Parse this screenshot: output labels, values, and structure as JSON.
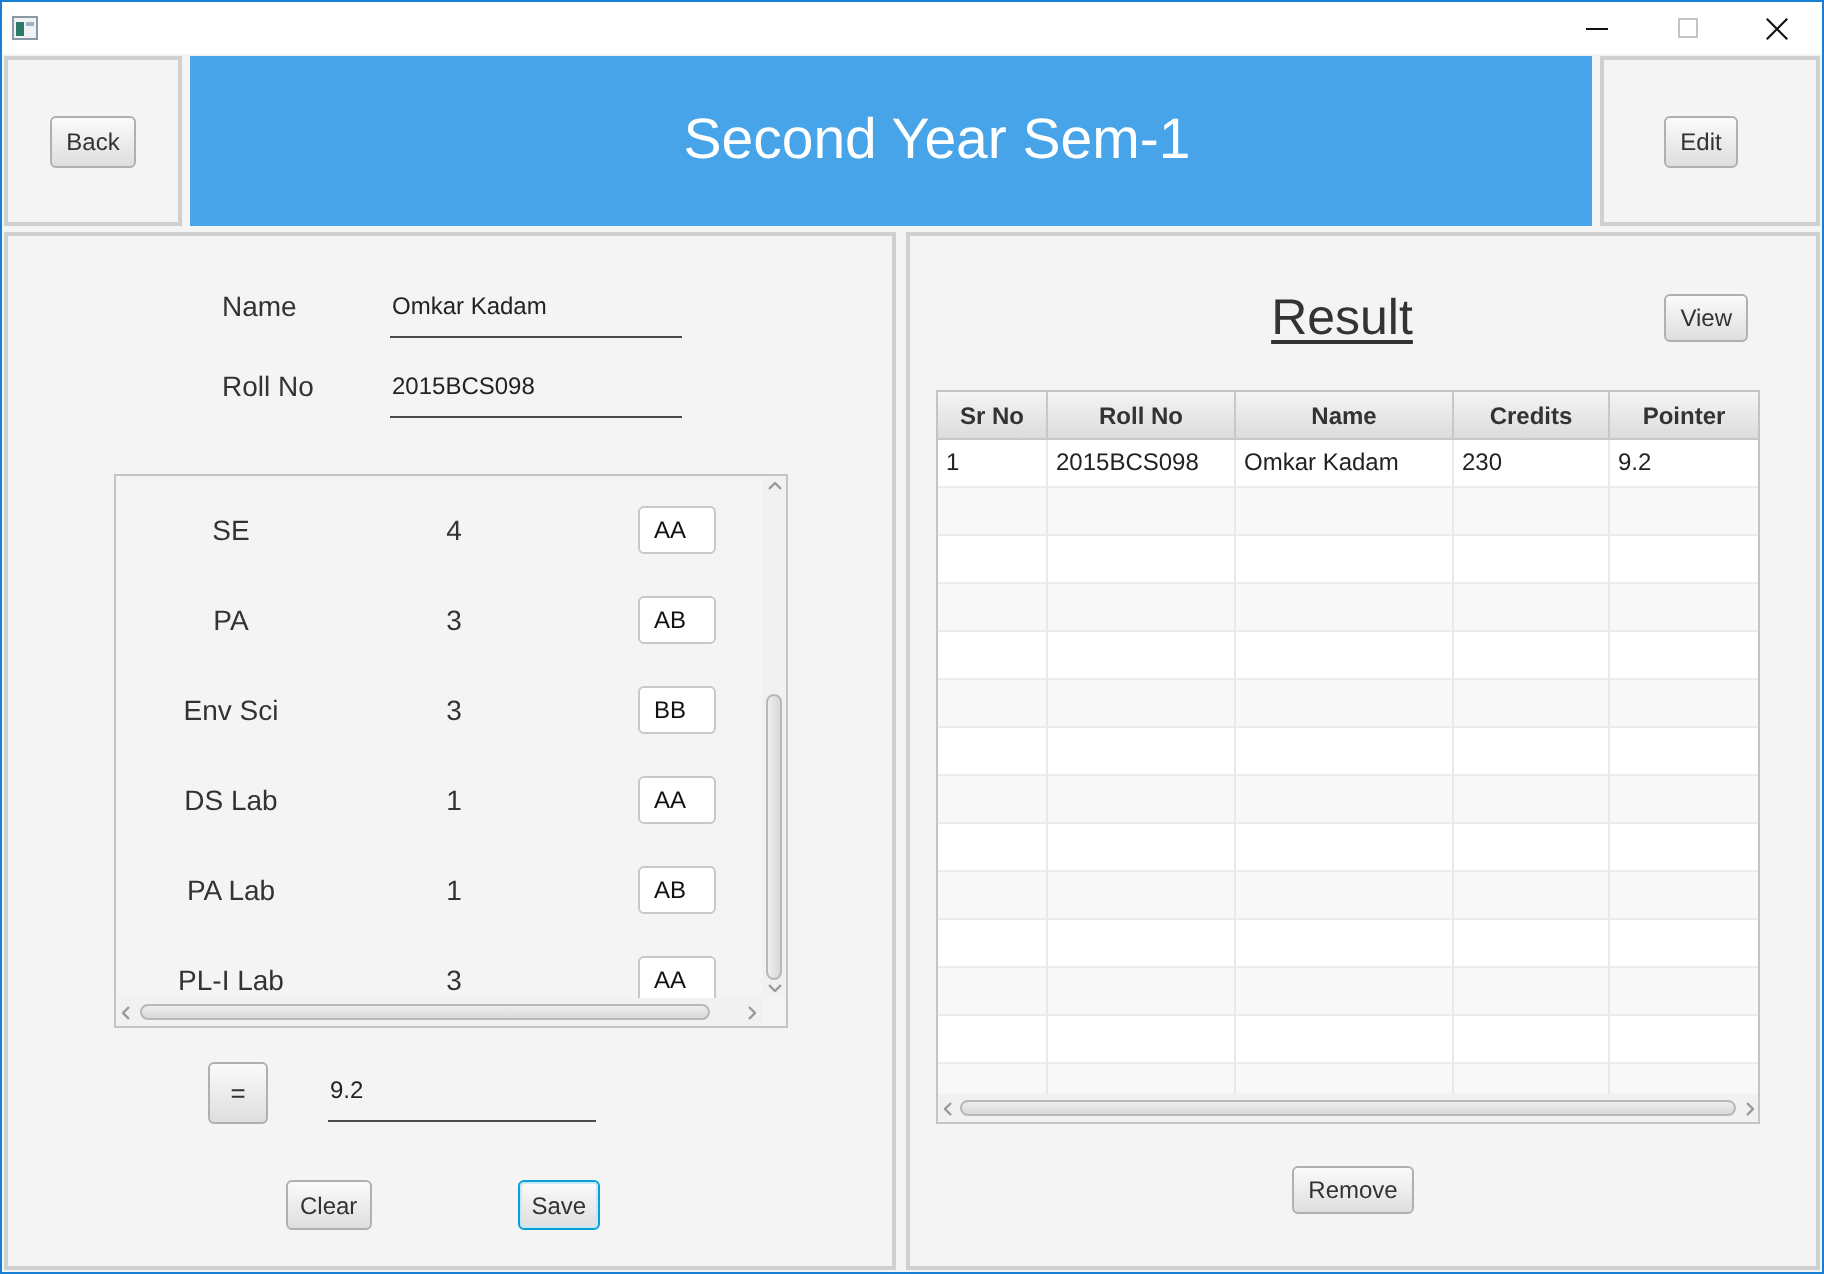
{
  "window": {
    "controls": [
      {
        "kind": "minimize",
        "disabled": false
      },
      {
        "kind": "maximize",
        "disabled": true
      },
      {
        "kind": "close",
        "disabled": false
      }
    ]
  },
  "header": {
    "back_button": "Back",
    "title": "Second Year Sem-1",
    "edit_button": "Edit"
  },
  "student": [
    {
      "label": "Name",
      "value": "Omkar Kadam"
    },
    {
      "label": "Roll No",
      "value": "2015BCS098"
    }
  ],
  "subjects": [
    {
      "name": "SE",
      "credits": "4",
      "grade": "AA"
    },
    {
      "name": "PA",
      "credits": "3",
      "grade": "AB"
    },
    {
      "name": "Env Sci",
      "credits": "3",
      "grade": "BB"
    },
    {
      "name": "DS Lab",
      "credits": "1",
      "grade": "AA"
    },
    {
      "name": "PA Lab",
      "credits": "1",
      "grade": "AB"
    },
    {
      "name": "PL-I Lab",
      "credits": "3",
      "grade": "AA"
    }
  ],
  "calculate": {
    "button": "=",
    "result": "9.2"
  },
  "actions": [
    {
      "label": "Clear",
      "focused": false
    },
    {
      "label": "Save",
      "focused": true
    }
  ],
  "result": {
    "title": "Result",
    "view_button": "View",
    "table": {
      "columns": [
        "Sr No",
        "Roll No",
        "Name",
        "Credits",
        "Pointer"
      ],
      "rows": [
        [
          "1",
          "2015BCS098",
          "Omkar Kadam",
          "230",
          "9.2"
        ]
      ]
    },
    "remove_button": "Remove"
  }
}
